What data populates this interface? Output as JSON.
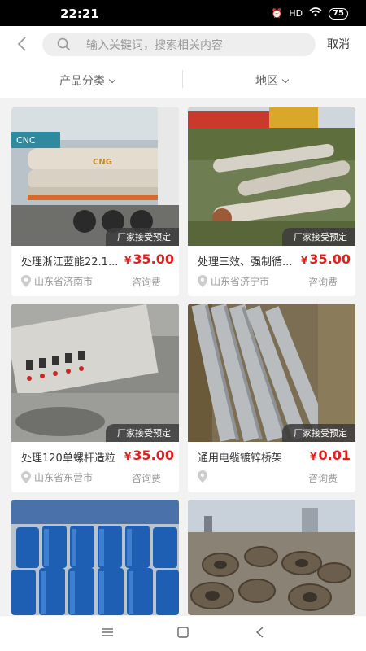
{
  "status_bar": {
    "time": "22:21",
    "signal": "HD",
    "battery": "75"
  },
  "search": {
    "placeholder": "输入关键词，搜索相关内容",
    "cancel_label": "取消"
  },
  "filters": {
    "category_label": "产品分类",
    "region_label": "地区"
  },
  "products": [
    {
      "title": "处理浙江蓝能22.1...",
      "price": "35.00",
      "location": "山东省济南市",
      "fee_label": "咨询费",
      "tag": "厂家接受预定"
    },
    {
      "title": "处理三效、强制循...",
      "price": "35.00",
      "location": "山东省济宁市",
      "fee_label": "咨询费",
      "tag": "厂家接受预定"
    },
    {
      "title": "处理120单螺杆造粒",
      "price": "35.00",
      "location": "山东省东营市",
      "fee_label": "咨询费",
      "tag": "厂家接受预定"
    },
    {
      "title": "通用电缆镀锌桥架",
      "price": "0.01",
      "location": "",
      "fee_label": "咨询费",
      "tag": "厂家接受预定"
    },
    {
      "title": "",
      "price": "",
      "location": "",
      "fee_label": "",
      "tag": ""
    },
    {
      "title": "",
      "price": "",
      "location": "",
      "fee_label": "",
      "tag": ""
    }
  ],
  "currency_symbol": "¥",
  "colors": {
    "price": "#e21f1f",
    "tag_bg": "#3c3c3c",
    "page_bg": "#f2f2f2"
  }
}
